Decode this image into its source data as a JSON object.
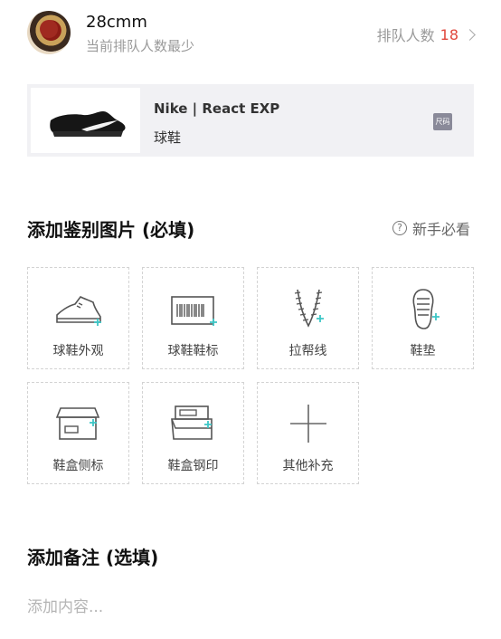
{
  "header": {
    "username": "28cmm",
    "subtitle": "当前排队人数最少",
    "queue_label": "排队人数",
    "queue_count": "18"
  },
  "product": {
    "brand": "Nike | React EXP",
    "category": "球鞋",
    "tag_icon": "size-tag-icon"
  },
  "photos": {
    "title": "添加鉴别图片 (必填)",
    "guide_label": "新手必看",
    "items": [
      {
        "label": "球鞋外观",
        "icon": "shoe-exterior-icon"
      },
      {
        "label": "球鞋鞋标",
        "icon": "shoe-label-barcode-icon"
      },
      {
        "label": "拉帮线",
        "icon": "stitching-icon"
      },
      {
        "label": "鞋垫",
        "icon": "insole-icon"
      },
      {
        "label": "鞋盒侧标",
        "icon": "box-side-label-icon"
      },
      {
        "label": "鞋盒钢印",
        "icon": "box-stamp-icon"
      },
      {
        "label": "其他补充",
        "icon": "add-more-icon"
      }
    ]
  },
  "notes": {
    "title": "添加备注 (选填)",
    "placeholder": "添加内容..."
  },
  "colors": {
    "accent_count": "#e0473c",
    "icon_plus": "#3cc6c6",
    "icon_stroke": "#555555"
  }
}
